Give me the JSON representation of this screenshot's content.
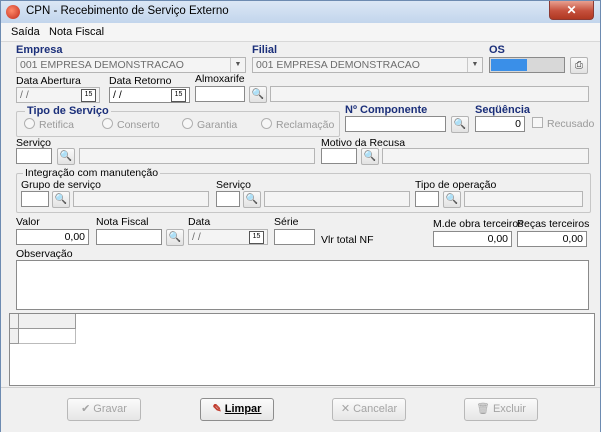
{
  "window": {
    "title": "CPN - Recebimento de Serviço Externo",
    "close_label": "✕"
  },
  "menu": {
    "items": [
      "Saída",
      "Nota Fiscal"
    ]
  },
  "empresa": {
    "label": "Empresa",
    "value": "001 EMPRESA DEMONSTRACAO"
  },
  "filial": {
    "label": "Filial",
    "value": "001 EMPRESA DEMONSTRACAO"
  },
  "os": {
    "label": "OS"
  },
  "data_abertura": {
    "label": "Data Abertura",
    "value": " /  /"
  },
  "data_retorno": {
    "label": "Data Retorno",
    "value": " /  /"
  },
  "almoxarife": {
    "label": "Almoxarife"
  },
  "tipo_servico": {
    "title": "Tipo de Serviço",
    "options": [
      "Retifica",
      "Conserto",
      "Garantia",
      "Reclamação"
    ]
  },
  "componente": {
    "label": "Nº  Componente"
  },
  "sequencia": {
    "label": "Seqüência",
    "value": "0"
  },
  "recusado": {
    "label": "Recusado"
  },
  "servico": {
    "label": "Serviço"
  },
  "motivo_recusa": {
    "label": "Motivo da Recusa"
  },
  "integracao": {
    "title": "Integração com manutenção",
    "grupo_label": "Grupo de serviço",
    "servico_label": "Serviço",
    "tipo_label": "Tipo de operação"
  },
  "valor": {
    "label": "Valor",
    "value": "0,00"
  },
  "nota_fiscal": {
    "label": "Nota Fiscal"
  },
  "data": {
    "label": "Data",
    "value": " /  /"
  },
  "serie": {
    "label": "Série"
  },
  "vlr_total_nf": {
    "label": "Vlr total NF"
  },
  "mobra": {
    "label": "M.de obra terceiros",
    "value": "0,00"
  },
  "pecas": {
    "label": "Peças terceiros",
    "value": "0,00"
  },
  "observacao": {
    "label": "Observação"
  },
  "buttons": {
    "gravar": "Gravar",
    "limpar": "Limpar",
    "cancelar": "Cancelar",
    "excluir": "Excluir"
  },
  "colors": {
    "title_bg": "#c2d5ec",
    "label_blue": "#1b2f7a",
    "os_fill": "#3a8fe8",
    "close_red": "#c5503c"
  }
}
